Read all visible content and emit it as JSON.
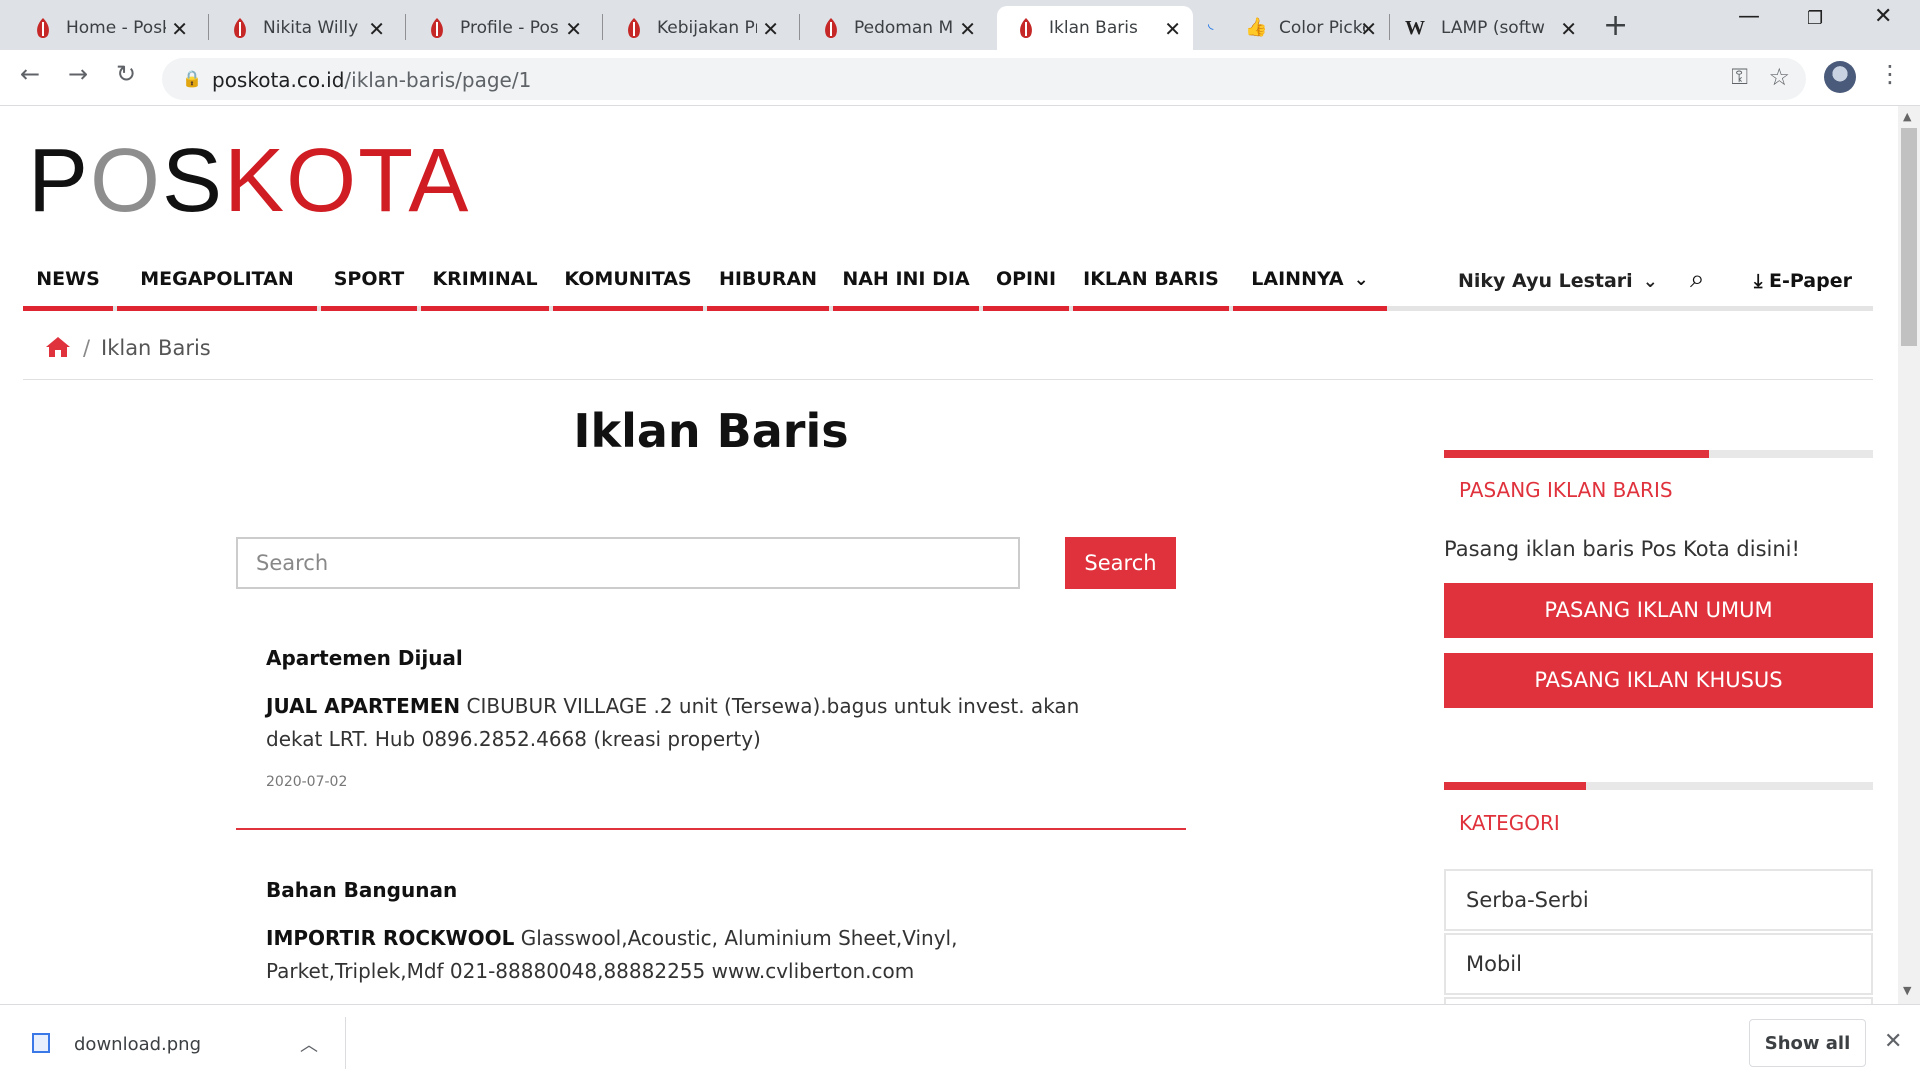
{
  "browser": {
    "tabs": [
      {
        "title": "Home - Poskota",
        "active": false,
        "icon": "poskota-favicon"
      },
      {
        "title": "Nikita Willy Dinyatakan",
        "active": false,
        "icon": "poskota-favicon"
      },
      {
        "title": "Profile - Poskota",
        "active": false,
        "icon": "poskota-favicon"
      },
      {
        "title": "Kebijakan Privasi",
        "active": false,
        "icon": "poskota-favicon"
      },
      {
        "title": "Pedoman Media",
        "active": false,
        "icon": "poskota-favicon"
      },
      {
        "title": "Iklan Baris - Poskota",
        "active": true,
        "icon": "poskota-favicon"
      },
      {
        "title": "Color Picker",
        "active": false,
        "icon": "thumbs-up-favicon"
      },
      {
        "title": "LAMP (software bundle)",
        "active": false,
        "icon": "wikipedia-favicon"
      }
    ],
    "url_host": "poskota.co.id",
    "url_path": "/iklan-baris/page/1"
  },
  "site": {
    "logo": {
      "pos": "P",
      "o": "O",
      "s": "S",
      "kota": "KOTA"
    },
    "nav": [
      "NEWS",
      "MEGAPOLITAN",
      "SPORT",
      "KRIMINAL",
      "KOMUNITAS",
      "HIBURAN",
      "NAH INI DIA",
      "OPINI",
      "IKLAN BARIS",
      "LAINNYA"
    ],
    "user_name": "Niky Ayu Lestari",
    "epaper_label": "E-Paper",
    "accent_color": "#e0323c"
  },
  "breadcrumb": {
    "current": "Iklan Baris"
  },
  "main": {
    "title": "Iklan Baris",
    "search_placeholder": "Search",
    "search_button": "Search",
    "ads": [
      {
        "category": "Apartemen Dijual",
        "headline": "JUAL APARTEMEN",
        "line1": " CIBUBUR VILLAGE .2 unit (Tersewa).bagus untuk invest. akan",
        "line2": "dekat LRT. Hub 0896.2852.4668 (kreasi property)",
        "date": "2020-07-02"
      },
      {
        "category": "Bahan Bangunan",
        "headline": "IMPORTIR ROCKWOOL",
        "line1": " Glasswool,Acoustic, Aluminium Sheet,Vinyl,",
        "line2": "Parket,Triplek,Mdf 021-88880048,88882255 www.cvliberton.com"
      }
    ]
  },
  "sidebar": {
    "pasang_heading": "PASANG IKLAN BARIS",
    "pasang_desc": "Pasang iklan baris Pos Kota disini!",
    "btn_umum": "PASANG IKLAN UMUM",
    "btn_khusus": "PASANG IKLAN KHUSUS",
    "kategori_heading": "KATEGORI",
    "categories": [
      "Serba-Serbi",
      "Mobil"
    ]
  },
  "downloads": {
    "file_name": "download.png",
    "show_all": "Show all"
  }
}
